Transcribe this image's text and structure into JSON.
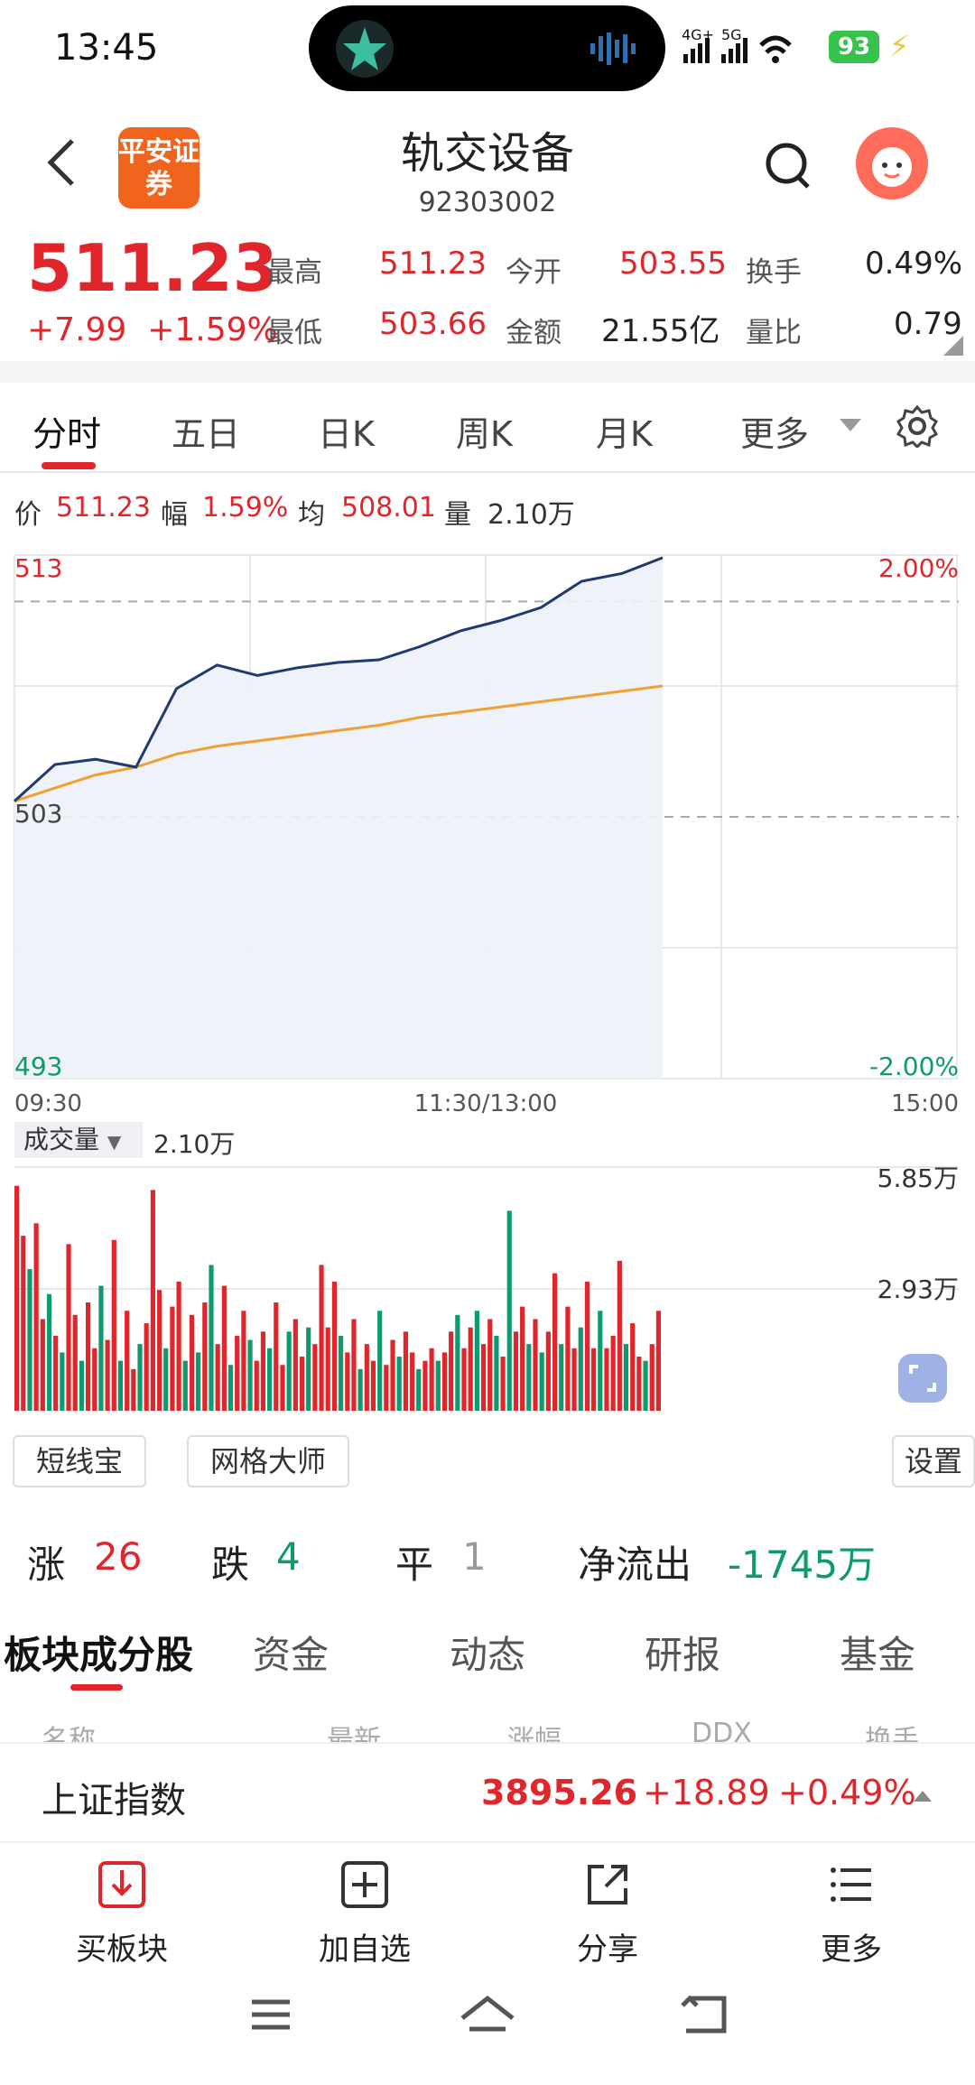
{
  "status_bar": {
    "time": "13:45",
    "signal": "4G+ 5G",
    "battery": "93"
  },
  "header": {
    "title": "轨交设备",
    "code": "92303002",
    "logo_text": "平安证券"
  },
  "quote": {
    "price": "511.23",
    "change": "+7.99",
    "change_pct": "+1.59%",
    "high_label": "最高",
    "high": "511.23",
    "low_label": "最低",
    "low": "503.66",
    "open_label": "今开",
    "open": "503.55",
    "amount_label": "金额",
    "amount": "21.55亿",
    "turnover_label": "换手",
    "turnover": "0.49%",
    "volratio_label": "量比",
    "volratio": "0.79"
  },
  "period_tabs": [
    "分时",
    "五日",
    "日K",
    "周K",
    "月K",
    "更多"
  ],
  "info_row": {
    "price_label": "价",
    "price": "511.23",
    "amp_label": "幅",
    "amp": "1.59%",
    "avg_label": "均",
    "avg": "508.01",
    "vol_label": "量",
    "vol": "2.10万"
  },
  "chart_data": {
    "type": "line",
    "title": "",
    "y_ticks_left": [
      "513",
      "503",
      "493"
    ],
    "y_ticks_right": [
      "2.00%",
      "-2.00%"
    ],
    "x_ticks": [
      "09:30",
      "11:30/13:00",
      "15:00"
    ],
    "ylim": [
      493,
      513
    ],
    "reference": 503,
    "x": [
      "09:30",
      "09:40",
      "09:50",
      "10:00",
      "10:10",
      "10:20",
      "10:30",
      "10:40",
      "10:50",
      "11:00",
      "11:10",
      "11:20",
      "11:30",
      "13:10",
      "13:20",
      "13:30",
      "13:40"
    ],
    "series": [
      {
        "values": [
          503.6,
          505.0,
          505.2,
          504.9,
          507.9,
          508.8,
          508.4,
          508.7,
          508.9,
          509.0,
          509.5,
          510.1,
          510.5,
          511.0,
          512.0,
          512.3,
          512.9
        ]
      },
      {
        "values": [
          503.6,
          504.1,
          504.6,
          504.9,
          505.4,
          505.7,
          505.9,
          506.1,
          506.3,
          506.5,
          506.8,
          507.0,
          507.2,
          507.4,
          507.6,
          507.8,
          508.0
        ]
      }
    ],
    "colors": {
      "price": "#1f3a6e",
      "avg": "#f0a030",
      "up": "#e0252b",
      "down": "#0e9a6c"
    }
  },
  "volume": {
    "selector_label": "成交量",
    "value": "2.10万",
    "y_ticks": [
      "5.85万",
      "2.93万"
    ],
    "ylim": [
      0,
      5.85
    ],
    "bars": [
      {
        "v": 5.4,
        "up": 1
      },
      {
        "v": 4.2,
        "up": 1
      },
      {
        "v": 3.4,
        "up": 0
      },
      {
        "v": 4.5,
        "up": 1
      },
      {
        "v": 2.2,
        "up": 1
      },
      {
        "v": 2.8,
        "up": 0
      },
      {
        "v": 1.8,
        "up": 1
      },
      {
        "v": 1.4,
        "up": 0
      },
      {
        "v": 4.0,
        "up": 1
      },
      {
        "v": 2.3,
        "up": 1
      },
      {
        "v": 1.2,
        "up": 0
      },
      {
        "v": 2.6,
        "up": 1
      },
      {
        "v": 1.5,
        "up": 1
      },
      {
        "v": 3.0,
        "up": 0
      },
      {
        "v": 1.7,
        "up": 1
      },
      {
        "v": 4.1,
        "up": 1
      },
      {
        "v": 1.2,
        "up": 0
      },
      {
        "v": 2.4,
        "up": 1
      },
      {
        "v": 1.0,
        "up": 1
      },
      {
        "v": 1.6,
        "up": 0
      },
      {
        "v": 2.1,
        "up": 1
      },
      {
        "v": 5.3,
        "up": 1
      },
      {
        "v": 2.9,
        "up": 1
      },
      {
        "v": 1.5,
        "up": 0
      },
      {
        "v": 2.5,
        "up": 1
      },
      {
        "v": 3.1,
        "up": 1
      },
      {
        "v": 1.2,
        "up": 0
      },
      {
        "v": 2.3,
        "up": 1
      },
      {
        "v": 1.4,
        "up": 0
      },
      {
        "v": 2.6,
        "up": 1
      },
      {
        "v": 3.5,
        "up": 0
      },
      {
        "v": 1.6,
        "up": 1
      },
      {
        "v": 3.0,
        "up": 1
      },
      {
        "v": 1.1,
        "up": 0
      },
      {
        "v": 1.8,
        "up": 1
      },
      {
        "v": 2.4,
        "up": 1
      },
      {
        "v": 1.7,
        "up": 0
      },
      {
        "v": 1.2,
        "up": 1
      },
      {
        "v": 1.9,
        "up": 1
      },
      {
        "v": 1.5,
        "up": 0
      },
      {
        "v": 2.6,
        "up": 1
      },
      {
        "v": 1.1,
        "up": 1
      },
      {
        "v": 1.9,
        "up": 0
      },
      {
        "v": 2.2,
        "up": 1
      },
      {
        "v": 1.3,
        "up": 1
      },
      {
        "v": 2.0,
        "up": 0
      },
      {
        "v": 1.6,
        "up": 1
      },
      {
        "v": 3.5,
        "up": 1
      },
      {
        "v": 2.0,
        "up": 1
      },
      {
        "v": 3.1,
        "up": 1
      },
      {
        "v": 1.8,
        "up": 0
      },
      {
        "v": 1.4,
        "up": 1
      },
      {
        "v": 2.2,
        "up": 1
      },
      {
        "v": 1.0,
        "up": 0
      },
      {
        "v": 1.6,
        "up": 1
      },
      {
        "v": 1.2,
        "up": 1
      },
      {
        "v": 2.4,
        "up": 0
      },
      {
        "v": 1.1,
        "up": 1
      },
      {
        "v": 1.7,
        "up": 1
      },
      {
        "v": 1.3,
        "up": 0
      },
      {
        "v": 1.9,
        "up": 1
      },
      {
        "v": 1.4,
        "up": 1
      },
      {
        "v": 1.0,
        "up": 0
      },
      {
        "v": 1.2,
        "up": 1
      },
      {
        "v": 1.5,
        "up": 1
      },
      {
        "v": 1.2,
        "up": 0
      },
      {
        "v": 1.4,
        "up": 1
      },
      {
        "v": 1.9,
        "up": 1
      },
      {
        "v": 2.3,
        "up": 0
      },
      {
        "v": 1.5,
        "up": 1
      },
      {
        "v": 2.0,
        "up": 1
      },
      {
        "v": 2.4,
        "up": 0
      },
      {
        "v": 1.6,
        "up": 1
      },
      {
        "v": 2.2,
        "up": 1
      },
      {
        "v": 1.8,
        "up": 0
      },
      {
        "v": 1.3,
        "up": 1
      },
      {
        "v": 4.8,
        "up": 0
      },
      {
        "v": 1.9,
        "up": 1
      },
      {
        "v": 2.5,
        "up": 1
      },
      {
        "v": 1.6,
        "up": 0
      },
      {
        "v": 2.2,
        "up": 1
      },
      {
        "v": 1.4,
        "up": 0
      },
      {
        "v": 1.9,
        "up": 1
      },
      {
        "v": 3.3,
        "up": 1
      },
      {
        "v": 1.6,
        "up": 0
      },
      {
        "v": 2.5,
        "up": 1
      },
      {
        "v": 1.5,
        "up": 1
      },
      {
        "v": 2.0,
        "up": 0
      },
      {
        "v": 3.1,
        "up": 1
      },
      {
        "v": 1.5,
        "up": 1
      },
      {
        "v": 2.4,
        "up": 0
      },
      {
        "v": 1.5,
        "up": 1
      },
      {
        "v": 1.8,
        "up": 1
      },
      {
        "v": 3.6,
        "up": 1
      },
      {
        "v": 1.6,
        "up": 0
      },
      {
        "v": 2.1,
        "up": 1
      },
      {
        "v": 1.3,
        "up": 1
      },
      {
        "v": 1.2,
        "up": 0
      },
      {
        "v": 1.6,
        "up": 1
      },
      {
        "v": 2.4,
        "up": 1
      }
    ]
  },
  "tools": {
    "short_line": "短线宝",
    "grid": "网格大师",
    "settings": "设置"
  },
  "stats": {
    "up_label": "涨",
    "up": "26",
    "down_label": "跌",
    "down": "4",
    "flat_label": "平",
    "flat": "1",
    "net_label": "净流出",
    "net": "-1745万"
  },
  "section_tabs": [
    "板块成分股",
    "资金",
    "动态",
    "研报",
    "基金"
  ],
  "columns": [
    "名称",
    "最新",
    "涨幅",
    "DDX",
    "换手"
  ],
  "index_bar": {
    "name": "上证指数",
    "value": "3895.26",
    "change": "+18.89",
    "pct": "+0.49%"
  },
  "bottom_bar": {
    "buy": "买板块",
    "add": "加自选",
    "share": "分享",
    "more": "更多"
  }
}
